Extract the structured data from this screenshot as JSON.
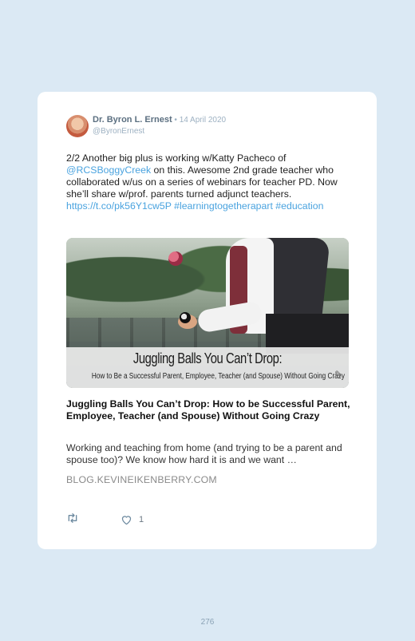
{
  "tweet": {
    "author_name": "Dr. Byron L. Ernest",
    "separator": " • ",
    "date": "14 April 2020",
    "handle": "@ByronErnest",
    "text_part1": "2/2 Another big plus is working w/Katty Pacheco of ",
    "mention": "@RCSBoggyCreek",
    "text_part2": " on this. Awesome 2nd grade teacher who collaborated w/us on a series of webinars for teacher PD. Now she’ll share w/prof. parents turned adjunct teachers. ",
    "url": "https://t.co/pk56Y1cw5P",
    "hashtag1": "#learningtogetherapart",
    "hashtag2": "#education"
  },
  "media": {
    "image_title": "Juggling Balls You Can’t Drop:",
    "image_subtitle": "How to Be a Successful Parent, Employee, Teacher (and Spouse) Without Going Crazy"
  },
  "link_card": {
    "title": "Juggling Balls You Can’t Drop: How to be Successful Parent, Employee, Teacher (and Spouse) Without Going Crazy",
    "description": "Working and teaching from home (and trying to be a parent and spouse too)? We know how hard it is and we want …",
    "domain": "BLOG.KEVINEIKENBERRY.COM"
  },
  "actions": {
    "like_count": "1"
  },
  "page": {
    "number": "276"
  },
  "colors": {
    "background": "#dbe9f4",
    "link": "#4aa3df",
    "author": "#5b6f80",
    "muted": "#9db1c2"
  }
}
